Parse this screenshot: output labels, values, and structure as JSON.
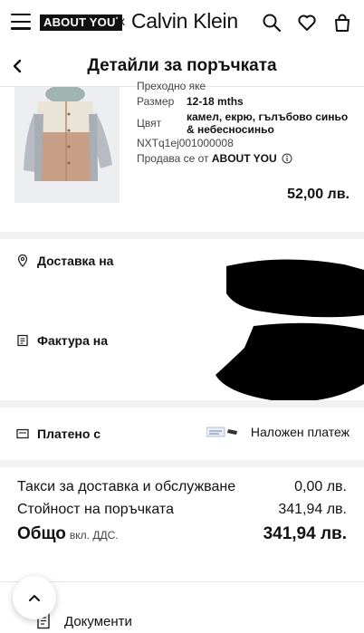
{
  "header": {
    "brand_primary": "ABOUT YOU",
    "brand_symbol": "°",
    "brand_separator": "x",
    "brand_partner": "Calvin Klein",
    "icons": [
      "menu-icon",
      "search-icon",
      "heart-icon",
      "bag-icon"
    ]
  },
  "nav": {
    "title": "Детайли за поръчката",
    "back_icon": "chevron-left-icon"
  },
  "product": {
    "name_cut": "Преходно яке",
    "size_label": "Размер",
    "size_value": "12-18 mths",
    "color_label": "Цвят",
    "color_value_line1": "камел, екрю, гълъбово синьо",
    "color_value_line2": "& небесносиньо",
    "sku": "NXTq1ej001000008",
    "seller_prefix": "Продава се от",
    "seller_name": "ABOUT YOU",
    "info_icon": "info-icon",
    "price": "52,00 лв."
  },
  "address": {
    "delivery_label": "Доставка на",
    "delivery_icon": "location-pin-icon",
    "invoice_label": "Фактура на",
    "invoice_icon": "invoice-icon"
  },
  "payment": {
    "label": "Платено с",
    "icon": "payment-card-icon",
    "method": "Наложен платеж",
    "method_icon": "cash-on-delivery-icon"
  },
  "totals": {
    "shipping_label": "Такси за доставка и обслужване",
    "shipping_value": "0,00 лв.",
    "order_label": "Стойност на поръчката",
    "order_value": "341,94 лв.",
    "total_label": "Общо",
    "vat_note": "вкл. ДДС.",
    "total_value": "341,94 лв."
  },
  "documents": {
    "label": "Документи",
    "icon": "document-icon"
  },
  "scroll_top": {
    "icon": "chevron-up-icon"
  }
}
